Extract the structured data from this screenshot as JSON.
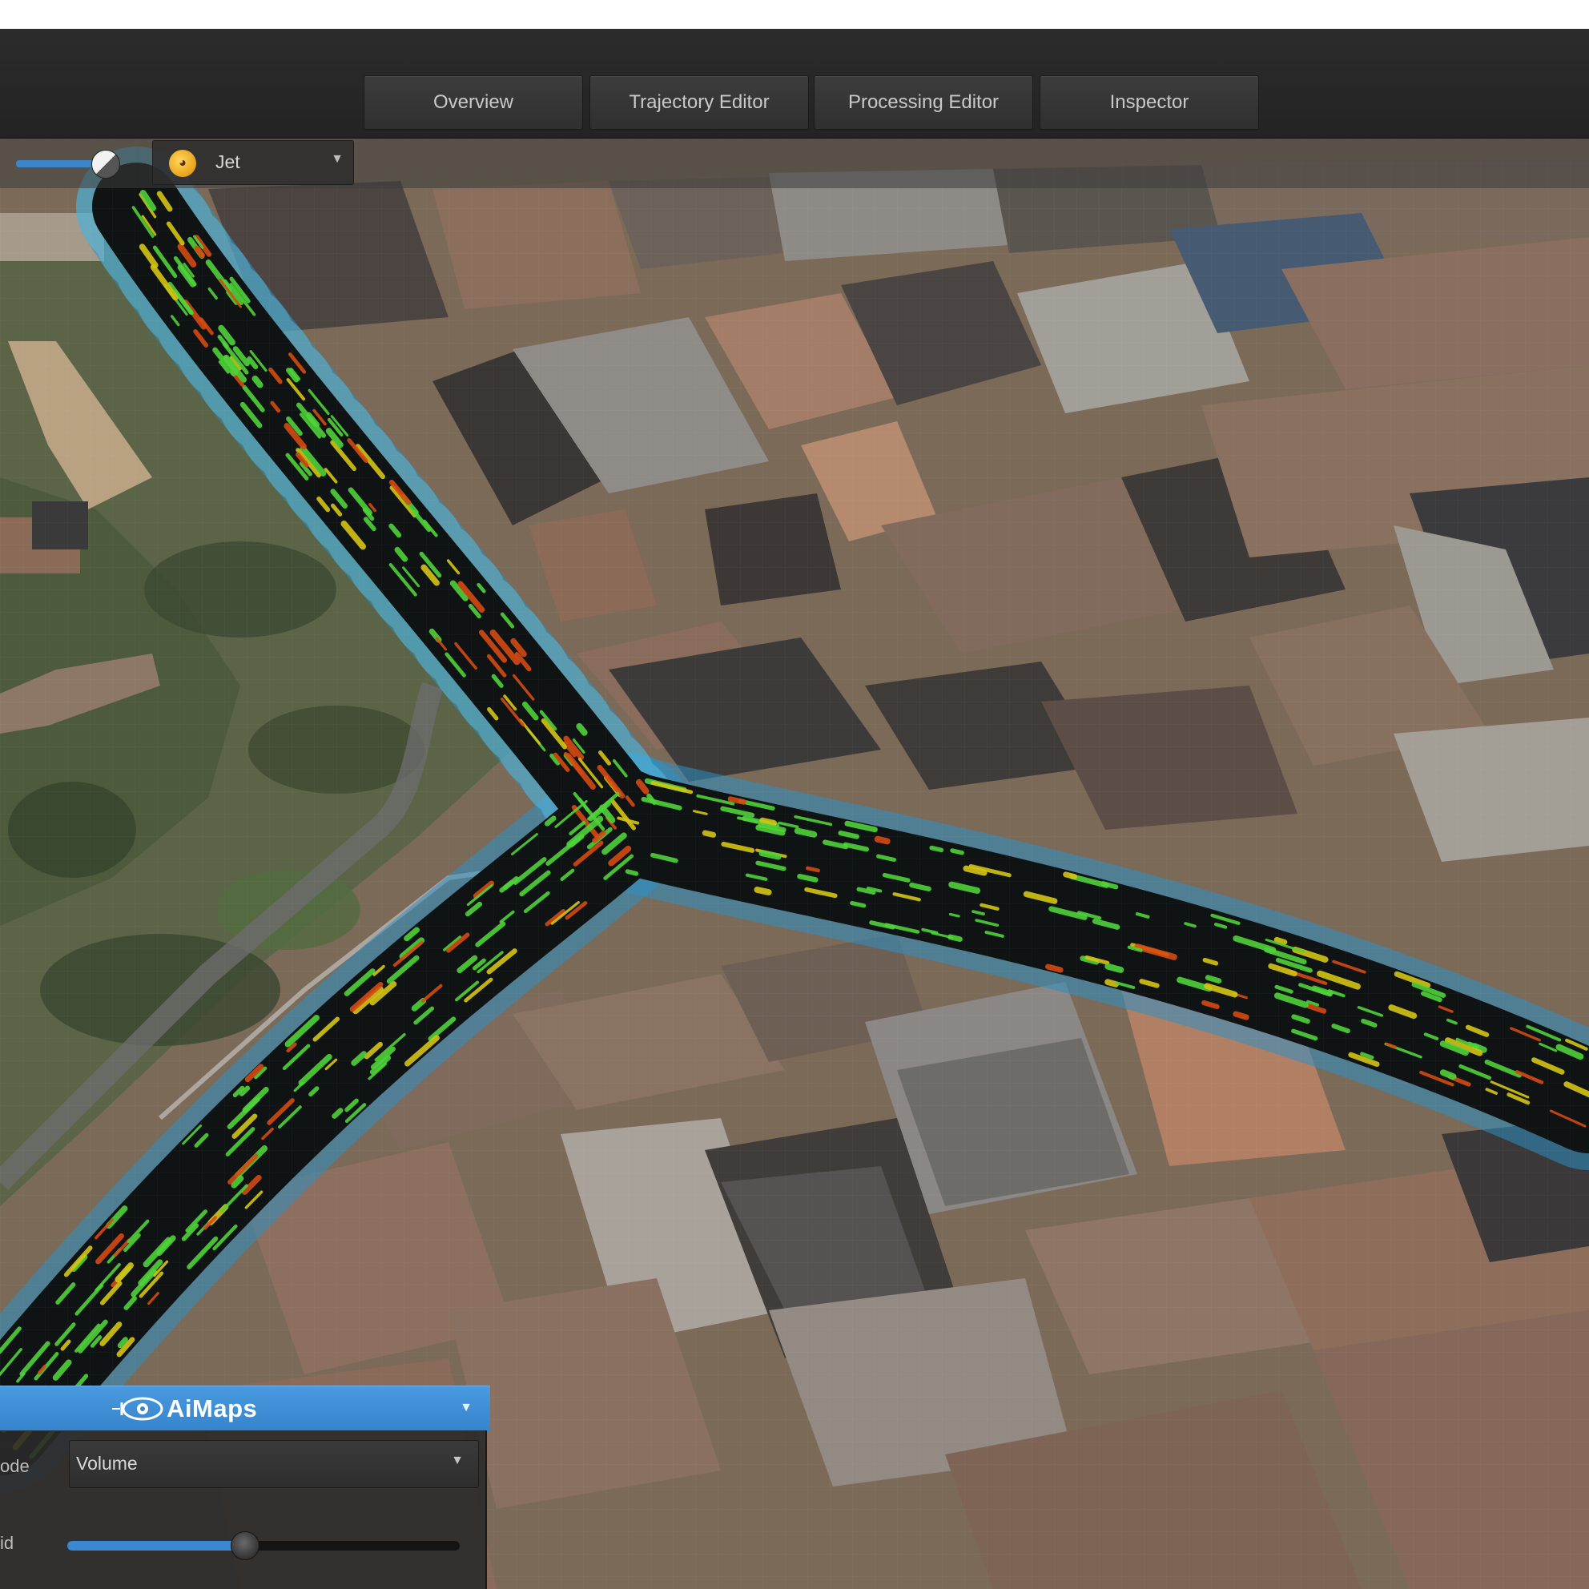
{
  "tabs": [
    {
      "label": "Overview"
    },
    {
      "label": "Trajectory Editor"
    },
    {
      "label": "Processing Editor"
    },
    {
      "label": "Inspector"
    }
  ],
  "toolbar": {
    "color_palette": {
      "selected": "Jet",
      "icon": "palette-icon"
    },
    "opacity_slider": {
      "value_fraction": 0.8
    }
  },
  "panel": {
    "logo_text": "AiMaps",
    "logo_icon": "eye-logo-icon",
    "mode_label": "ode",
    "mode_value": "Volume",
    "scale_label": "id",
    "scale_slider": {
      "value_fraction": 0.45
    }
  },
  "colors": {
    "accent_blue": "#3b88d0",
    "header_blue": "#4a9ae0",
    "road_band": "#2f8fc0",
    "points_green": "#4fd23a",
    "points_yellow": "#d4c414",
    "points_red": "#d44a12"
  }
}
